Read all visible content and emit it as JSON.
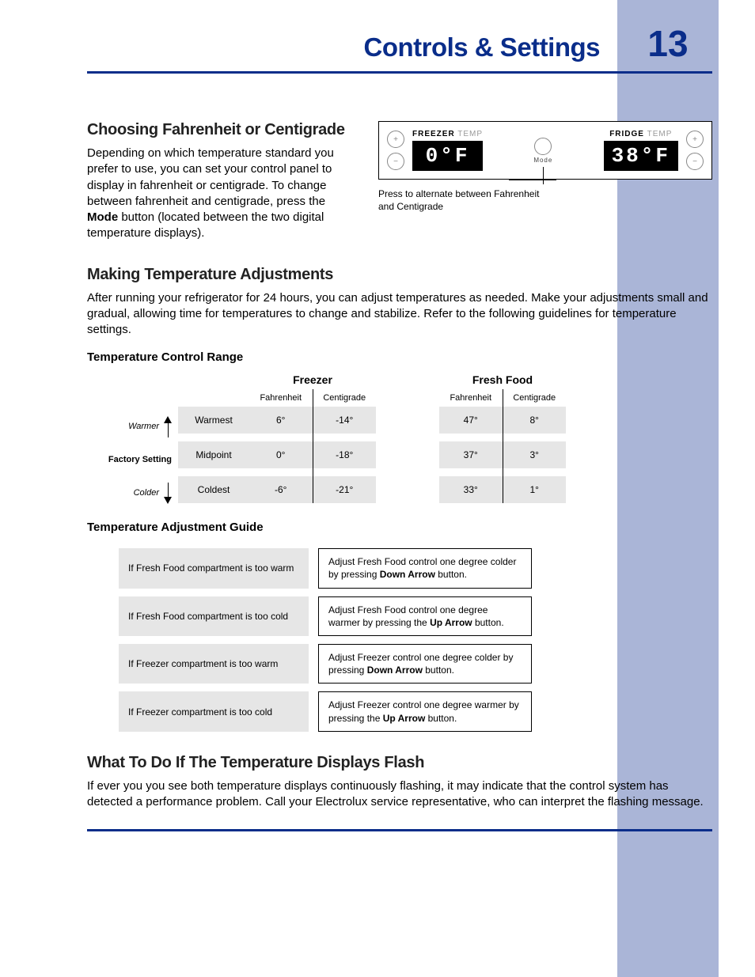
{
  "header": {
    "title": "Controls & Settings",
    "page": "13"
  },
  "s1": {
    "h": "Choosing Fahrenheit or Centigrade",
    "p1a": "Depending on which temperature standard you prefer to use, you can set your control panel to display in fahrenheit or centigrade. To change between fahrenheit and centigrade, press the ",
    "p1b": "Mode",
    "p1c": " button (located between the two digital temperature displays)."
  },
  "panel": {
    "freezer_label_b": "FREEZER",
    "freezer_label_g": " TEMP",
    "fridge_label_b": "FRIDGE",
    "fridge_label_g": " TEMP",
    "freezer_val": "0°F",
    "fridge_val": "38°F",
    "mode": "Mode",
    "caption": "Press to alternate between Fahrenheit and Centigrade"
  },
  "s2": {
    "h": "Making Temperature Adjustments",
    "p": "After running your refrigerator for 24 hours, you can adjust temperatures as needed. Make your adjustments small and gradual, allowing time for temperatures to change and stabilize. Refer to the following guidelines for temperature settings."
  },
  "range": {
    "h": "Temperature Control Range",
    "freezer": "Freezer",
    "fresh": "Fresh Food",
    "fah": "Fahrenheit",
    "cen": "Centigrade",
    "warmer": "Warmer",
    "colder": "Colder",
    "factory": "Factory Setting",
    "rows": [
      {
        "label": "Warmest",
        "ff": "6°",
        "fc": "-14°",
        "rf": "47°",
        "rc": "8°"
      },
      {
        "label": "Midpoint",
        "ff": "0°",
        "fc": "-18°",
        "rf": "37°",
        "rc": "3°"
      },
      {
        "label": "Coldest",
        "ff": "-6°",
        "fc": "-21°",
        "rf": "33°",
        "rc": "1°"
      }
    ]
  },
  "guide": {
    "h": "Temperature Adjustment Guide",
    "rows": [
      {
        "cond": "If Fresh Food compartment is too warm",
        "a1": "Adjust Fresh Food control one degree colder by pressing ",
        "ab": "Down Arrow",
        "a2": " button."
      },
      {
        "cond": "If Fresh Food compartment is too cold",
        "a1": "Adjust Fresh Food control one degree warmer by pressing the ",
        "ab": "Up Arrow",
        "a2": " button."
      },
      {
        "cond": "If Freezer compartment is too warm",
        "a1": "Adjust Freezer control one degree colder by pressing ",
        "ab": "Down Arrow",
        "a2": " button."
      },
      {
        "cond": "If Freezer compartment is too cold",
        "a1": "Adjust Freezer control one degree warmer by pressing the ",
        "ab": "Up Arrow",
        "a2": " button."
      }
    ]
  },
  "s3": {
    "h": "What To Do If The Temperature Displays Flash",
    "p": "If ever you you see both temperature displays continuously flashing, it may indicate that the control system has detected a performance problem. Call your Electrolux service representative, who can interpret the flashing message."
  }
}
